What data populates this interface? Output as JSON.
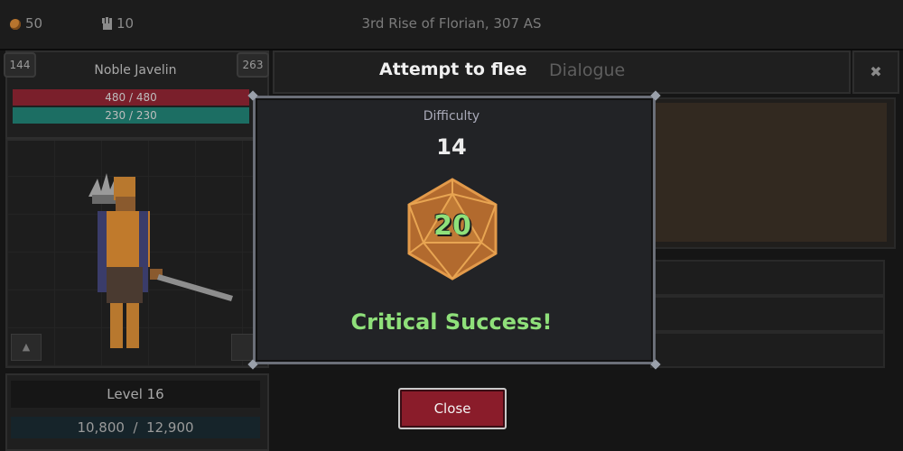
{
  "topbar": {
    "gold": "50",
    "units": "10",
    "date": "3rd Rise of Florian, 307 AS"
  },
  "character": {
    "left_stat": "144",
    "right_stat": "263",
    "name": "Noble Javelin",
    "health": "480 / 480",
    "energy": "230 / 230",
    "level": "Level 16",
    "xp": "10,800  /  12,900"
  },
  "header": {
    "title": "Attempt to flee",
    "tab": "Dialogue",
    "close_glyph": "✖"
  },
  "roll": {
    "difficulty_label": "Difficulty",
    "difficulty": "14",
    "die_result": "20",
    "outcome": "Critical Success!"
  },
  "close_button": "Close",
  "colors": {
    "health": "#7a1f2b",
    "energy": "#1c6e63",
    "success": "#8fe07a",
    "button": "#8a1c2a",
    "die": "#b26a2e"
  },
  "icons": {
    "gold": "coin-icon",
    "units": "fist-icon",
    "close": "x-icon",
    "die": "d20-icon"
  }
}
